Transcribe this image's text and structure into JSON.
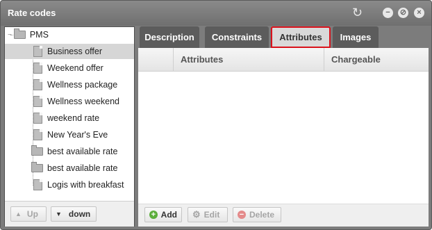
{
  "window": {
    "title": "Rate codes"
  },
  "titlebar": {
    "refresh_icon": "refresh-icon",
    "minimize_icon": "minimize-icon",
    "restore_icon": "restore-icon",
    "close_icon": "close-icon"
  },
  "tree": {
    "root": "PMS",
    "items": [
      {
        "label": "Business offer",
        "icon": "file-icon",
        "selected": true
      },
      {
        "label": "Weekend offer",
        "icon": "file-icon"
      },
      {
        "label": "Wellness package",
        "icon": "file-icon"
      },
      {
        "label": "Wellness weekend",
        "icon": "file-icon"
      },
      {
        "label": "weekend rate",
        "icon": "file-icon"
      },
      {
        "label": "New Year's Eve",
        "icon": "file-icon"
      },
      {
        "label": "best available rate",
        "icon": "folder-icon"
      },
      {
        "label": "best available rate",
        "icon": "folder-icon"
      },
      {
        "label": "Logis with breakfast",
        "icon": "file-icon"
      }
    ]
  },
  "left_footer": {
    "up_label": "Up",
    "down_label": "down"
  },
  "tabs": [
    {
      "label": "Description"
    },
    {
      "label": "Constraints"
    },
    {
      "label": "Attributes",
      "active": true
    },
    {
      "label": "Images"
    }
  ],
  "grid": {
    "columns": [
      "Attributes",
      "Chargeable"
    ]
  },
  "right_footer": {
    "add_label": "Add",
    "edit_label": "Edit",
    "delete_label": "Delete"
  },
  "colors": {
    "titlebar": "#7c7c7c",
    "active_tab_border": "#d9111b",
    "selection": "#d6d6d6",
    "add_icon": "#5cae3c",
    "delete_icon": "#e48a8a"
  }
}
